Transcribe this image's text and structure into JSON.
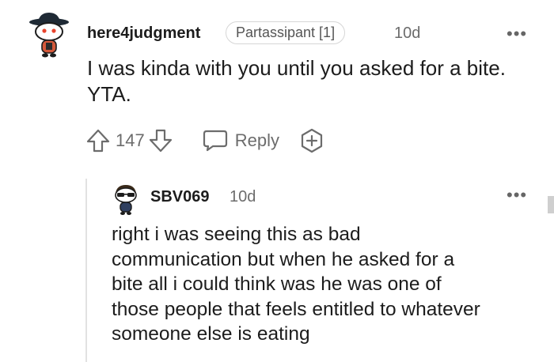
{
  "colors": {
    "text": "#1a1a1b",
    "muted": "#6c6c6c",
    "thread_line": "#e2e2e2"
  },
  "comment": {
    "avatar_icon": "snoo-cowboy-hat-avatar-icon",
    "username": "here4judgment",
    "flair": "Partassipant [1]",
    "time": "10d",
    "more_label": "•••",
    "body_lines": [
      "I was kinda with you until you asked for a bite.",
      "YTA."
    ],
    "score": "147",
    "reply_label": "Reply"
  },
  "reply": {
    "avatar_icon": "snoo-sunglasses-avatar-icon",
    "username": "SBV069",
    "time": "10d",
    "more_label": "•••",
    "body_lines": [
      "right i was seeing this as bad",
      "communication but when he asked for a",
      "bite all i could think was he was one of",
      "those people that feels entitled to whatever",
      "someone else is eating"
    ]
  }
}
